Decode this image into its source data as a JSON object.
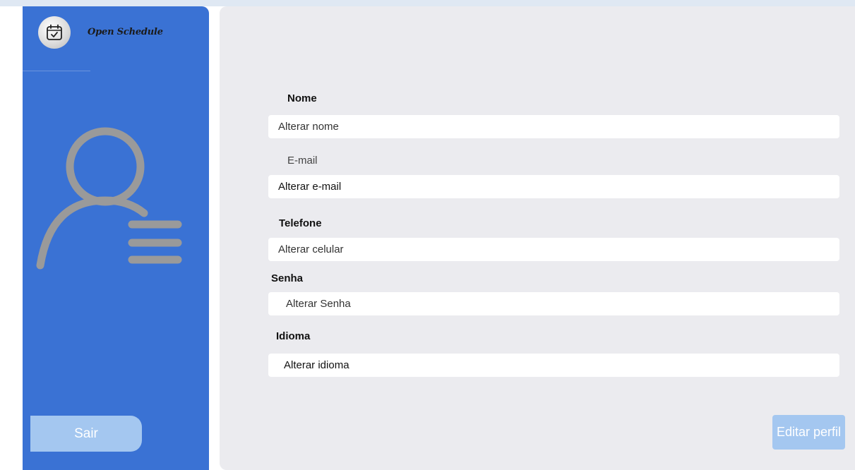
{
  "app": {
    "brand": "Open Schedule"
  },
  "sidebar": {
    "logout_label": "Sair"
  },
  "form": {
    "name": {
      "label": "Nome",
      "placeholder": "Alterar nome"
    },
    "email": {
      "label": "E-mail",
      "placeholder": "Alterar e-mail"
    },
    "phone": {
      "label": "Telefone",
      "placeholder": "Alterar celular"
    },
    "password": {
      "label": "Senha",
      "placeholder": "Alterar Senha"
    },
    "language": {
      "label": "Idioma",
      "placeholder": "Alterar idioma"
    },
    "submit_label": "Editar perfil"
  },
  "colors": {
    "sidebar": "#3a72d4",
    "button": "#a4c7f0",
    "content_bg": "#ebebef",
    "icon_gray": "#9a9a9a"
  },
  "icons": {
    "logo": "calendar-check-icon",
    "profile": "user-list-icon"
  }
}
